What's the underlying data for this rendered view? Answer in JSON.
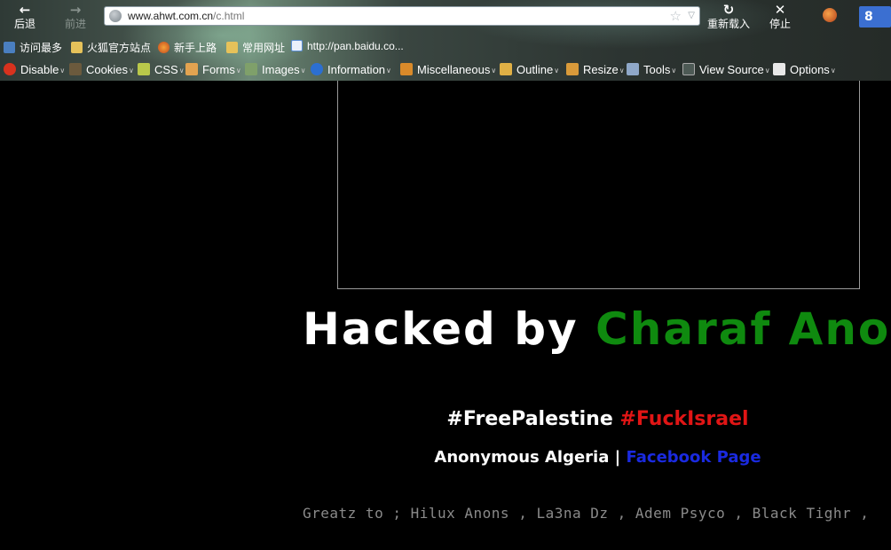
{
  "browser": {
    "back_label": "后退",
    "forward_label": "前进",
    "reload_label": "重新载入",
    "stop_label": "停止",
    "url_domain": "www.ahwt.com.cn",
    "url_path": "/c.html",
    "search_engine": "8"
  },
  "bookmarks": [
    {
      "label": "访问最多",
      "icon": "search-page-icon"
    },
    {
      "label": "火狐官方站点",
      "icon": "folder-icon"
    },
    {
      "label": "新手上路",
      "icon": "firefox-icon"
    },
    {
      "label": "常用网址",
      "icon": "folder-icon"
    },
    {
      "label": "http://pan.baidu.co...",
      "icon": "baidu-cloud-icon"
    }
  ],
  "devtoolbar": [
    {
      "label": "Disable",
      "icon": "disable-icon"
    },
    {
      "label": "Cookies",
      "icon": "cookies-icon"
    },
    {
      "label": "CSS",
      "icon": "css-icon"
    },
    {
      "label": "Forms",
      "icon": "forms-icon"
    },
    {
      "label": "Images",
      "icon": "images-icon"
    },
    {
      "label": "Information",
      "icon": "information-icon"
    },
    {
      "label": "Miscellaneous",
      "icon": "miscellaneous-icon"
    },
    {
      "label": "Outline",
      "icon": "outline-icon"
    },
    {
      "label": "Resize",
      "icon": "resize-icon"
    },
    {
      "label": "Tools",
      "icon": "tools-icon"
    },
    {
      "label": "View Source",
      "icon": "view-source-icon"
    },
    {
      "label": "Options",
      "icon": "options-icon"
    }
  ],
  "content": {
    "headline_prefix": "Hacked by ",
    "headline_name": "Charaf Anons",
    "tag_free": "#FreePalestine",
    "tag_fuck": "#FuckIsrael",
    "credit_group": "Anonymous Algeria",
    "credit_sep": "|",
    "credit_link": "Facebook Page",
    "greetz": "Greatz to ; Hilux Anons , La3na Dz , Adem Psyco , Black Tighr ,"
  },
  "colors": {
    "headline_green": "#0f8a0f",
    "tag_red": "#e01515",
    "link_blue": "#1a2ae0",
    "greetz_gray": "#8a8a8a"
  }
}
